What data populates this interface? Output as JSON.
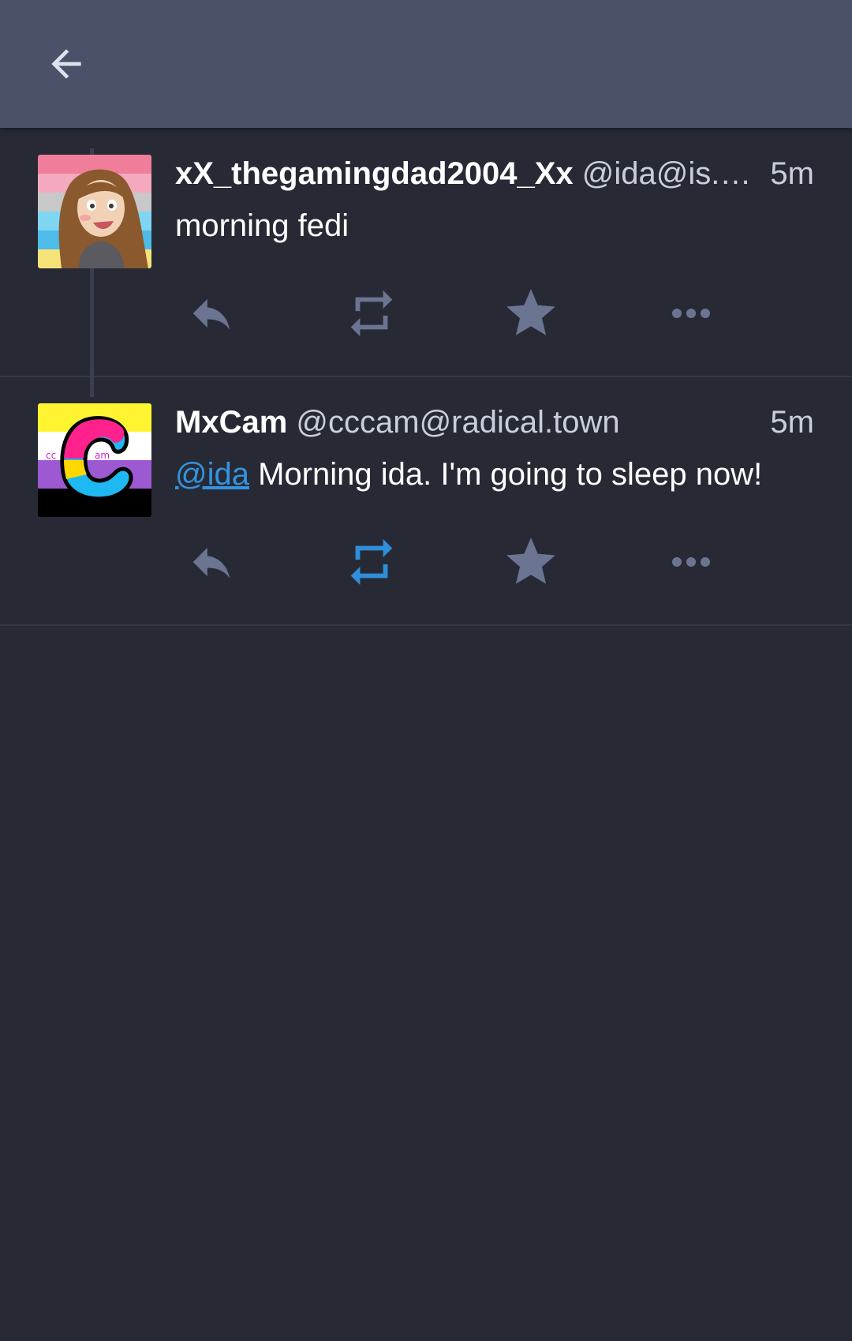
{
  "header": {
    "back_icon": "arrow-left-icon"
  },
  "colors": {
    "topbar": "#4b5169",
    "background": "#272a35",
    "icon_default": "#6b7592",
    "icon_active": "#2f8ddb",
    "link": "#3393e0"
  },
  "posts": [
    {
      "display_name": "xX_thegamingdad2004_Xx",
      "handle": "@ida@is.nota.live",
      "time": "5m",
      "content": "morning fedi",
      "boosted": false,
      "actions": [
        "reply-icon",
        "boost-icon",
        "favourite-icon",
        "more-icon"
      ]
    },
    {
      "display_name": "MxCam",
      "handle": "@cccam@radical.town",
      "time": "5m",
      "mention": "@ida",
      "content": " Morning ida. I'm going to sleep now!",
      "boosted": true,
      "avatar_letters": [
        "cc",
        "am",
        "C"
      ],
      "actions": [
        "reply-icon",
        "boost-icon",
        "favourite-icon",
        "more-icon"
      ]
    }
  ]
}
